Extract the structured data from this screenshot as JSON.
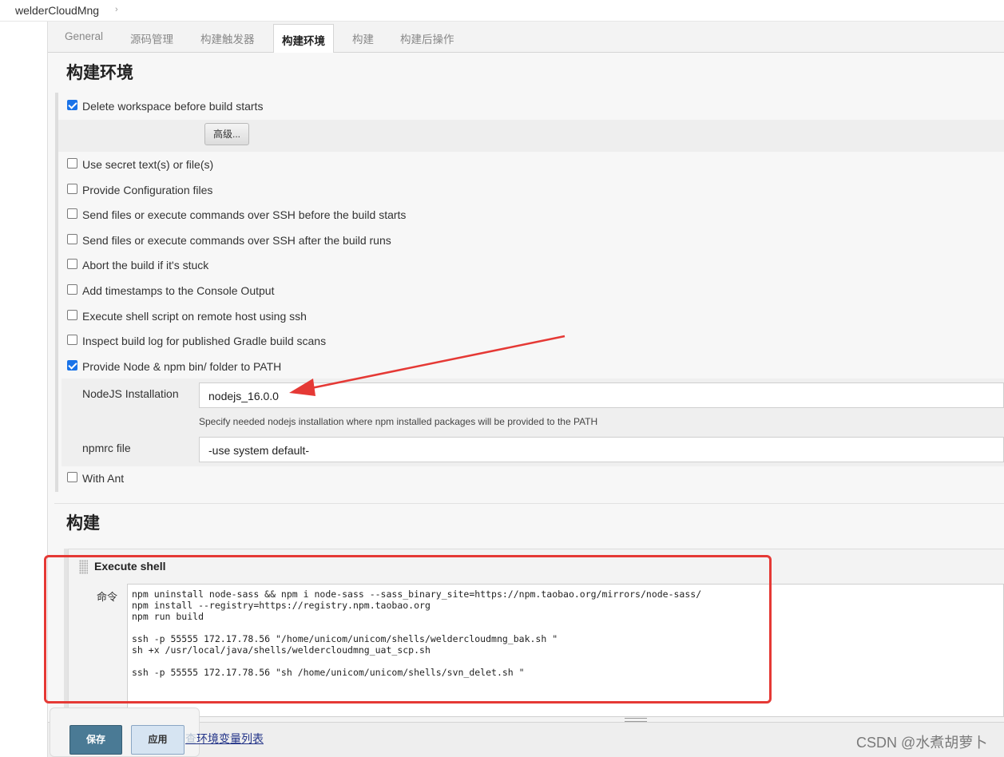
{
  "breadcrumb": {
    "project": "welderCloudMng",
    "chevron": "›"
  },
  "tabs": [
    {
      "label": "General"
    },
    {
      "label": "源码管理"
    },
    {
      "label": "构建触发器"
    },
    {
      "label": "构建环境"
    },
    {
      "label": "构建"
    },
    {
      "label": "构建后操作"
    }
  ],
  "active_tab": "构建环境",
  "build_env": {
    "title": "构建环境",
    "advanced_button": "高级...",
    "options": [
      {
        "label": "Delete workspace before build starts",
        "checked": true
      },
      {
        "label": "Use secret text(s) or file(s)",
        "checked": false
      },
      {
        "label": "Provide Configuration files",
        "checked": false
      },
      {
        "label": "Send files or execute commands over SSH before the build starts",
        "checked": false
      },
      {
        "label": "Send files or execute commands over SSH after the build runs",
        "checked": false
      },
      {
        "label": "Abort the build if it's stuck",
        "checked": false
      },
      {
        "label": "Add timestamps to the Console Output",
        "checked": false
      },
      {
        "label": "Execute shell script on remote host using ssh",
        "checked": false
      },
      {
        "label": "Inspect build log for published Gradle build scans",
        "checked": false
      },
      {
        "label": "Provide Node & npm bin/ folder to PATH",
        "checked": true
      },
      {
        "label": "With Ant",
        "checked": false
      }
    ],
    "nodejs_installation": {
      "label": "NodeJS Installation",
      "value": "nodejs_16.0.0",
      "hint": "Specify needed nodejs installation where npm installed packages will be provided to the PATH"
    },
    "npmrc": {
      "label": "npmrc file",
      "value": "-use system default-"
    }
  },
  "build": {
    "title": "构建",
    "step_title": "Execute shell",
    "command_label": "命令",
    "command_lines": [
      "npm uninstall node-sass && npm i node-sass --sass_binary_site=https://npm.taobao.org/mirrors/node-sass/",
      "npm install --registry=https://registry.npm.taobao.org",
      "npm run build",
      "",
      "ssh -p 55555 172.17.78.56 \"/home/unicom/unicom/shells/weldercloudmng_bak.sh \"",
      "sh +x /usr/local/java/shells/weldercloudmng_uat_scp.sh",
      "",
      "ssh -p 55555 172.17.78.56 \"sh /home/unicom/unicom/shells/svn_delet.sh \""
    ]
  },
  "footer": {
    "save": "保存",
    "apply": "应用",
    "env_link_faded": "查",
    "env_link": "环境变量列表"
  },
  "watermark": "CSDN @水煮胡萝卜",
  "annotation_colors": {
    "arrow": "#e53935",
    "highlight_box": "#e53935"
  }
}
